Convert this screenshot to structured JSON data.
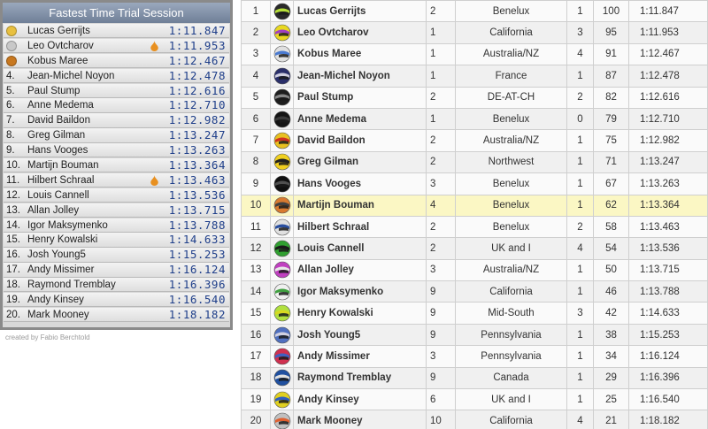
{
  "left_panel": {
    "title": "Fastest Time Trial Session",
    "credit": "created by Fabio Berchtold",
    "rows": [
      {
        "pos": "",
        "name": "Lucas Gerrijts",
        "time": "1:11.847",
        "medal": "gold",
        "drop": false
      },
      {
        "pos": "",
        "name": "Leo Ovtcharov",
        "time": "1:11.953",
        "medal": "silver",
        "drop": true
      },
      {
        "pos": "",
        "name": "Kobus Maree",
        "time": "1:12.467",
        "medal": "bronze",
        "drop": false
      },
      {
        "pos": "4.",
        "name": "Jean-Michel Noyon",
        "time": "1:12.478",
        "drop": false
      },
      {
        "pos": "5.",
        "name": "Paul Stump",
        "time": "1:12.616",
        "drop": false
      },
      {
        "pos": "6.",
        "name": "Anne Medema",
        "time": "1:12.710",
        "drop": false
      },
      {
        "pos": "7.",
        "name": "David Baildon",
        "time": "1:12.982",
        "drop": false
      },
      {
        "pos": "8.",
        "name": "Greg Gilman",
        "time": "1:13.247",
        "drop": false
      },
      {
        "pos": "9.",
        "name": "Hans Vooges",
        "time": "1:13.263",
        "drop": false
      },
      {
        "pos": "10.",
        "name": "Martijn Bouman",
        "time": "1:13.364",
        "drop": false
      },
      {
        "pos": "11.",
        "name": "Hilbert Schraal",
        "time": "1:13.463",
        "drop": true
      },
      {
        "pos": "12.",
        "name": "Louis Cannell",
        "time": "1:13.536",
        "drop": false
      },
      {
        "pos": "13.",
        "name": "Allan Jolley",
        "time": "1:13.715",
        "drop": false
      },
      {
        "pos": "14.",
        "name": "Igor Maksymenko",
        "time": "1:13.788",
        "drop": false
      },
      {
        "pos": "15.",
        "name": "Henry Kowalski",
        "time": "1:14.633",
        "drop": false
      },
      {
        "pos": "16.",
        "name": "Josh Young5",
        "time": "1:15.253",
        "drop": false
      },
      {
        "pos": "17.",
        "name": "Andy Missimer",
        "time": "1:16.124",
        "drop": false
      },
      {
        "pos": "18.",
        "name": "Raymond Tremblay",
        "time": "1:16.396",
        "drop": false
      },
      {
        "pos": "19.",
        "name": "Andy Kinsey",
        "time": "1:16.540",
        "drop": false
      },
      {
        "pos": "20.",
        "name": "Mark Mooney",
        "time": "1:18.182",
        "drop": false
      }
    ]
  },
  "results": {
    "highlight_row": 10,
    "rows": [
      {
        "pos": "1",
        "name": "Lucas Gerrijts",
        "cls": "2",
        "region": "Benelux",
        "a": "1",
        "b": "100",
        "time": "1:11.847",
        "helmet": [
          "#2a2a2a",
          "#b7e03a"
        ]
      },
      {
        "pos": "2",
        "name": "Leo Ovtcharov",
        "cls": "1",
        "region": "California",
        "a": "3",
        "b": "95",
        "time": "1:11.953",
        "helmet": [
          "#e8d820",
          "#a040c0"
        ]
      },
      {
        "pos": "3",
        "name": "Kobus Maree",
        "cls": "1",
        "region": "Australia/NZ",
        "a": "4",
        "b": "91",
        "time": "1:12.467",
        "helmet": [
          "#e0e0e0",
          "#4a7ad0"
        ]
      },
      {
        "pos": "4",
        "name": "Jean-Michel Noyon",
        "cls": "1",
        "region": "France",
        "a": "1",
        "b": "87",
        "time": "1:12.478",
        "helmet": [
          "#2a2f6a",
          "#d0d0e0"
        ]
      },
      {
        "pos": "5",
        "name": "Paul Stump",
        "cls": "2",
        "region": "DE-AT-CH",
        "a": "2",
        "b": "82",
        "time": "1:12.616",
        "helmet": [
          "#1e1e1e",
          "#888888"
        ]
      },
      {
        "pos": "6",
        "name": "Anne Medema",
        "cls": "1",
        "region": "Benelux",
        "a": "0",
        "b": "79",
        "time": "1:12.710",
        "helmet": [
          "#141414",
          "#3a3a3a"
        ]
      },
      {
        "pos": "7",
        "name": "David Baildon",
        "cls": "2",
        "region": "Australia/NZ",
        "a": "1",
        "b": "75",
        "time": "1:12.982",
        "helmet": [
          "#e8c020",
          "#d03020"
        ]
      },
      {
        "pos": "8",
        "name": "Greg Gilman",
        "cls": "2",
        "region": "Northwest",
        "a": "1",
        "b": "71",
        "time": "1:13.247",
        "helmet": [
          "#f0d020",
          "#202020"
        ]
      },
      {
        "pos": "9",
        "name": "Hans Vooges",
        "cls": "3",
        "region": "Benelux",
        "a": "1",
        "b": "67",
        "time": "1:13.263",
        "helmet": [
          "#101010",
          "#505050"
        ]
      },
      {
        "pos": "10",
        "name": "Martijn Bouman",
        "cls": "4",
        "region": "Benelux",
        "a": "1",
        "b": "62",
        "time": "1:13.364",
        "helmet": [
          "#d87a30",
          "#404040"
        ]
      },
      {
        "pos": "11",
        "name": "Hilbert Schraal",
        "cls": "2",
        "region": "Benelux",
        "a": "2",
        "b": "58",
        "time": "1:13.463",
        "helmet": [
          "#e0e0e0",
          "#2a4fa0"
        ]
      },
      {
        "pos": "12",
        "name": "Louis Cannell",
        "cls": "2",
        "region": "UK and I",
        "a": "4",
        "b": "54",
        "time": "1:13.536",
        "helmet": [
          "#30a030",
          "#1a1a1a"
        ]
      },
      {
        "pos": "13",
        "name": "Allan Jolley",
        "cls": "3",
        "region": "Australia/NZ",
        "a": "1",
        "b": "50",
        "time": "1:13.715",
        "helmet": [
          "#c040c0",
          "#e8e8e8"
        ]
      },
      {
        "pos": "14",
        "name": "Igor Maksymenko",
        "cls": "9",
        "region": "California",
        "a": "1",
        "b": "46",
        "time": "1:13.788",
        "helmet": [
          "#f0f0f0",
          "#40a040"
        ]
      },
      {
        "pos": "15",
        "name": "Henry Kowalski",
        "cls": "9",
        "region": "Mid-South",
        "a": "3",
        "b": "42",
        "time": "1:14.633",
        "helmet": [
          "#b0e040",
          "#d8d820"
        ]
      },
      {
        "pos": "16",
        "name": "Josh Young5",
        "cls": "9",
        "region": "Pennsylvania",
        "a": "1",
        "b": "38",
        "time": "1:15.253",
        "helmet": [
          "#5070c0",
          "#d0d0e0"
        ]
      },
      {
        "pos": "17",
        "name": "Andy Missimer",
        "cls": "3",
        "region": "Pennsylvania",
        "a": "1",
        "b": "34",
        "time": "1:16.124",
        "helmet": [
          "#d03050",
          "#4060c0"
        ]
      },
      {
        "pos": "18",
        "name": "Raymond Tremblay",
        "cls": "9",
        "region": "Canada",
        "a": "1",
        "b": "29",
        "time": "1:16.396",
        "helmet": [
          "#2050a0",
          "#e0e0e0"
        ]
      },
      {
        "pos": "19",
        "name": "Andy Kinsey",
        "cls": "6",
        "region": "UK and I",
        "a": "1",
        "b": "25",
        "time": "1:16.540",
        "helmet": [
          "#e0d020",
          "#3060c0"
        ]
      },
      {
        "pos": "20",
        "name": "Mark Mooney",
        "cls": "10",
        "region": "California",
        "a": "4",
        "b": "21",
        "time": "1:18.182",
        "helmet": [
          "#c0c0c0",
          "#e06030"
        ]
      }
    ]
  },
  "colors": {
    "medal_gold": "#e8c040",
    "medal_silver": "#c8c8c8",
    "medal_bronze": "#c87820",
    "drop": "#e89020",
    "time_blue": "#1f3f8a",
    "highlight": "#fbf7c4"
  },
  "icons": {
    "medal": "medal-icon",
    "drop": "flame-drop-icon",
    "helmet": "helmet-icon"
  }
}
